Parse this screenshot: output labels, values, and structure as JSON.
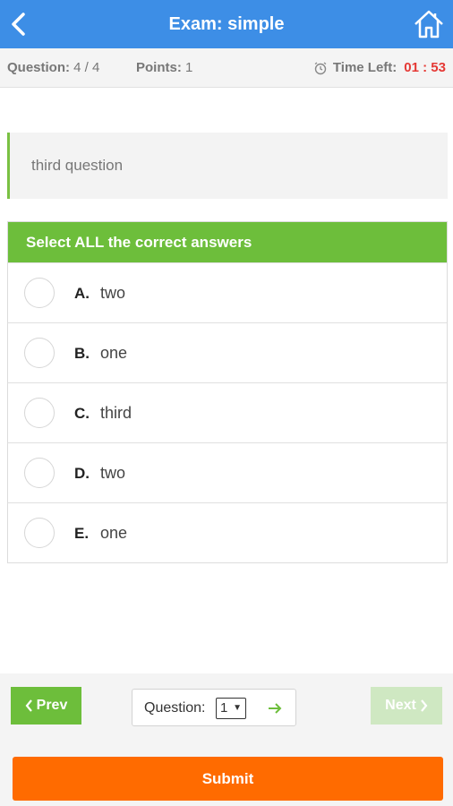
{
  "header": {
    "title": "Exam: simple"
  },
  "info": {
    "question_label": "Question:",
    "question_value": "4 / 4",
    "points_label": "Points:",
    "points_value": "1",
    "time_label": "Time Left:",
    "time_value": "01 : 53"
  },
  "question": {
    "text": "third question"
  },
  "answers": {
    "header": "Select ALL the correct answers",
    "options": [
      {
        "letter": "A.",
        "text": "two"
      },
      {
        "letter": "B.",
        "text": "one"
      },
      {
        "letter": "C.",
        "text": "third"
      },
      {
        "letter": "D.",
        "text": "two"
      },
      {
        "letter": "E.",
        "text": "one"
      }
    ]
  },
  "nav": {
    "prev_label": "Prev",
    "next_label": "Next",
    "question_select_label": "Question:",
    "question_select_value": "1"
  },
  "submit_label": "Submit",
  "colors": {
    "header_bg": "#3d8ee6",
    "accent_green": "#6dbe3b",
    "submit_orange": "#ff6b00",
    "timer_red": "#e53935"
  },
  "icons": [
    "back-arrow-icon",
    "home-icon",
    "alarm-clock-icon",
    "chevron-left-icon",
    "chevron-right-icon",
    "arrow-right-icon"
  ]
}
